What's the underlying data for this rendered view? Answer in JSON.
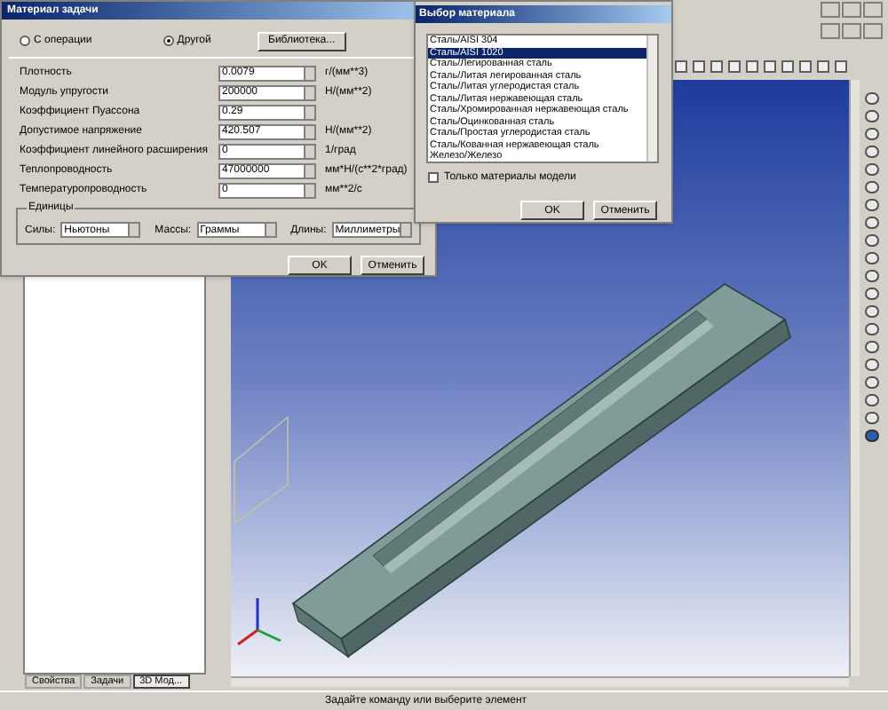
{
  "app": {
    "status_bar": "Задайте команду или выберите элемент",
    "panel_tabs": [
      {
        "label": "Свойства",
        "selected": false
      },
      {
        "label": "Задачи",
        "selected": false
      },
      {
        "label": "3D Мод...",
        "selected": true
      }
    ]
  },
  "material_dialog": {
    "title": "Материал задачи",
    "source_options": [
      {
        "label": "С операции",
        "selected": false
      },
      {
        "label": "Другой",
        "selected": true
      }
    ],
    "library_button": "Библиотека...",
    "properties": [
      {
        "label": "Плотность",
        "value": "0.0079",
        "unit": "г/(мм**3)"
      },
      {
        "label": "Модуль упругости",
        "value": "200000",
        "unit": "Н/(мм**2)"
      },
      {
        "label": "Коэффициент Пуассона",
        "value": "0.29"
      },
      {
        "label": "Допустимое напряжение",
        "value": "420.507",
        "unit": "Н/(мм**2)"
      },
      {
        "label": "Коэффициент линейного расширения",
        "value": "0",
        "unit": "1/град"
      },
      {
        "label": "Теплопроводность",
        "value": "47000000",
        "unit": "мм*Н/(с**2*град)"
      },
      {
        "label": "Температуропроводность",
        "value": "0",
        "unit": "мм**2/с"
      }
    ],
    "units_group": {
      "title": "Единицы",
      "fields": [
        {
          "label": "Силы:",
          "value": "Ньютоны"
        },
        {
          "label": "Массы:",
          "value": "Граммы"
        },
        {
          "label": "Длины:",
          "value": "Миллиметры"
        }
      ]
    },
    "buttons": [
      "OK",
      "Отменить"
    ]
  },
  "library_dialog": {
    "title": "Выбор материала",
    "materials": [
      {
        "label": "Сталь/AISI 304",
        "selected": false
      },
      {
        "label": "Сталь/AISI 1020",
        "selected": true
      },
      {
        "label": "Сталь/Легированная сталь",
        "selected": false
      },
      {
        "label": "Сталь/Литая легированная сталь",
        "selected": false
      },
      {
        "label": "Сталь/Литая углеродистая сталь",
        "selected": false
      },
      {
        "label": "Сталь/Литая нержавеющая сталь",
        "selected": false
      },
      {
        "label": "Сталь/Хромированная нержавеющая сталь",
        "selected": false
      },
      {
        "label": "Сталь/Оцинкованная сталь",
        "selected": false
      },
      {
        "label": "Сталь/Простая углеродистая сталь",
        "selected": false
      },
      {
        "label": "Сталь/Кованная нержавеющая сталь",
        "selected": false
      },
      {
        "label": "Железо/Железо",
        "selected": false
      }
    ],
    "only_model": {
      "label": "Только материалы модели",
      "checked": false
    },
    "buttons": [
      "OK",
      "Отменить"
    ]
  }
}
